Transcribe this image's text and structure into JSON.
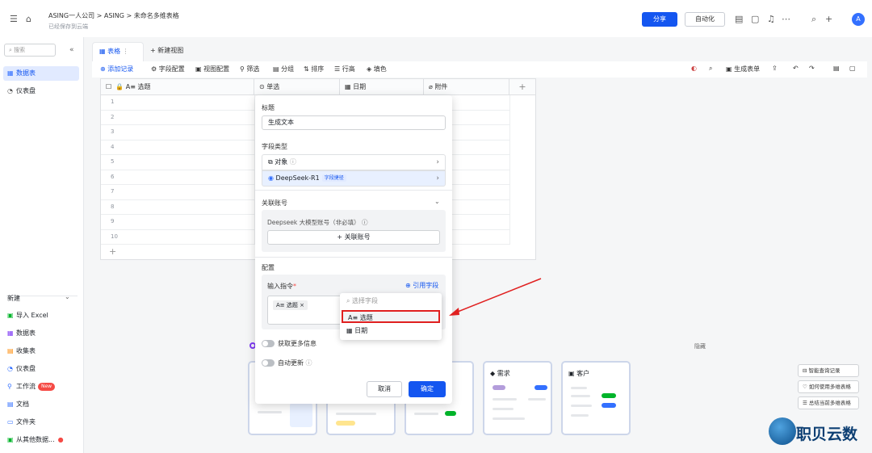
{
  "header": {
    "breadcrumb": "ASING一人公司 > ASING > 未命名多维表格",
    "saved_status": "已经保存到云端",
    "share_label": "分享",
    "automation_label": "自动化",
    "avatar_letter": "A",
    "accent": "#1456f0"
  },
  "sidebar": {
    "search_placeholder": "搜索",
    "items": [
      {
        "label": "数据表"
      },
      {
        "label": "仪表盘"
      }
    ],
    "new_label": "新建",
    "new_items": [
      {
        "label": "导入 Excel"
      },
      {
        "label": "数据表"
      },
      {
        "label": "收集表"
      },
      {
        "label": "仪表盘"
      },
      {
        "label": "工作流",
        "badge": "New"
      },
      {
        "label": "文档"
      },
      {
        "label": "文件夹"
      },
      {
        "label": "从其他数据..."
      }
    ]
  },
  "tabs": {
    "table_label": "表格",
    "new_view_label": "新建视图"
  },
  "toolbar": {
    "add_record": "添加记录",
    "field_config": "字段配置",
    "view_config": "视图配置",
    "filter": "筛选",
    "group": "分组",
    "sort": "排序",
    "row_height": "行高",
    "fill_color": "填色",
    "generate_form": "生成表单"
  },
  "grid": {
    "columns": [
      "选题",
      "单选",
      "日期",
      "附件"
    ],
    "rows": [
      "1",
      "2",
      "3",
      "4",
      "5",
      "6",
      "7",
      "8",
      "9",
      "10"
    ]
  },
  "panel": {
    "title_label": "标题",
    "title_value": "生成文本",
    "field_type_label": "字段类型",
    "opt_object": "对象",
    "opt_deepseek": "DeepSeek-R1",
    "deepseek_tag": "字段捷径",
    "linked_account_label": "关联账号",
    "account_hint": "Deepseek 大模型账号（非必填）",
    "link_account_btn": "+ 关联账号",
    "config_label": "配置",
    "prompt_label": "输入指令",
    "ref_field": "引用字段",
    "prompt_chip": "选题",
    "more_info": "获取更多信息",
    "auto_update": "自动更新",
    "cancel": "取消",
    "confirm": "确定"
  },
  "field_dropdown": {
    "placeholder": "选择字段",
    "items": [
      "选题",
      "日期"
    ]
  },
  "templates": {
    "hide": "隐藏",
    "cards": [
      "需求",
      "客户"
    ]
  },
  "right_links": [
    "智能查询记录",
    "如何使用多维表格",
    "总结当前多维表格"
  ],
  "watermark": "职贝云数"
}
